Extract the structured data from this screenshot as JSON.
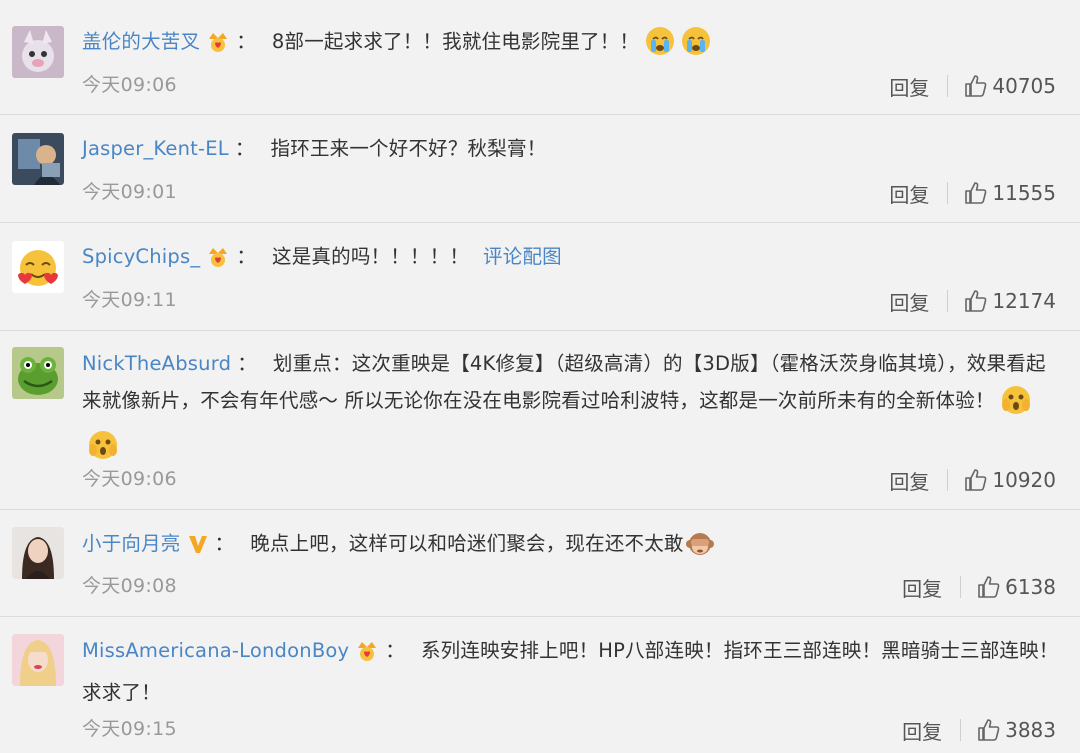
{
  "comments": [
    {
      "username": "盖伦的大苦叉",
      "separator": "：",
      "text": "8部一起求求了！！我就住电影院里了！！",
      "time": "今天09:06",
      "reply": "回复",
      "likes": "40705",
      "badge": "crown-heart-icon",
      "emoji": [
        "crying-face-icon",
        "crying-face-icon"
      ]
    },
    {
      "username": "Jasper_Kent-EL",
      "separator": "：",
      "text": "指环王来一个好不好？秋梨膏！",
      "time": "今天09:01",
      "reply": "回复",
      "likes": "11555"
    },
    {
      "username": "SpicyChips_",
      "separator": "：",
      "text": "这是真的吗！！！！！",
      "link": "评论配图",
      "time": "今天09:11",
      "reply": "回复",
      "likes": "12174",
      "badge": "crown-heart-icon"
    },
    {
      "username": "NickTheAbsurd",
      "separator": "：",
      "text": "划重点：这次重映是【4K修复】（超级高清）的【3D版】（霍格沃茨身临其境），效果看起来就像新片，不会有年代感～ 所以无论你在没在电影院看过哈利波特，这都是一次前所未有的全新体验！",
      "time": "今天09:06",
      "reply": "回复",
      "likes": "10920",
      "emoji": [
        "shocked-face-icon",
        "shocked-face-icon"
      ]
    },
    {
      "username": "小于向月亮",
      "separator": "：",
      "text": "晚点上吧，这样可以和哈迷们聚会，现在还不太敢",
      "time": "今天09:08",
      "reply": "回复",
      "likes": "6138",
      "badge": "verified-v-icon",
      "emoji": [
        "see-no-evil-monkey-icon"
      ]
    },
    {
      "username": "MissAmericana-LondonBoy",
      "separator": "：",
      "text": "系列连映安排上吧！HP八部连映！指环王三部连映！黑暗骑士三部连映！求求了！",
      "time": "今天09:15",
      "reply": "回复",
      "likes": "3883",
      "badge": "crown-heart-icon"
    }
  ],
  "colors": {
    "background": "#f2f2f2",
    "username": "#4a86c5",
    "time": "#999999",
    "divider": "#dcdcdc"
  }
}
